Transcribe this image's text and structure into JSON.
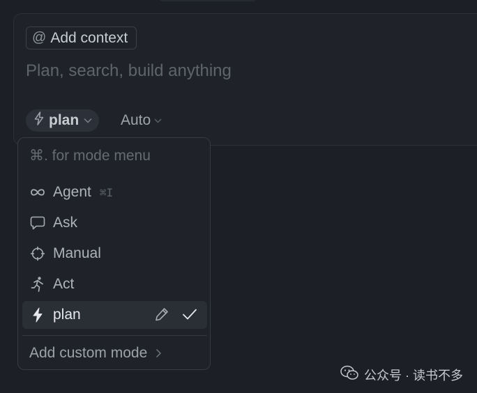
{
  "composer": {
    "add_context_label": "Add context",
    "prompt_placeholder": "Plan, search, build anything",
    "mode_label": "plan",
    "model_label": "Auto"
  },
  "mode_menu": {
    "hint": "⌘. for mode menu",
    "items": [
      {
        "label": "Agent",
        "icon": "infinity-icon",
        "shortcut": "⌘I"
      },
      {
        "label": "Ask",
        "icon": "chat-bubble-icon"
      },
      {
        "label": "Manual",
        "icon": "crosshair-icon"
      },
      {
        "label": "Act",
        "icon": "running-figure-icon"
      },
      {
        "label": "plan",
        "icon": "lightning-icon",
        "selected": true
      }
    ],
    "add_custom_label": "Add custom mode"
  },
  "watermark": {
    "text": "公众号 · 读书不多"
  },
  "colors": {
    "background": "#1c1f26",
    "composer_bg": "#1f2229",
    "selected_bg": "#2a2e35",
    "text": "#c9ced6",
    "muted": "#5f646c"
  }
}
